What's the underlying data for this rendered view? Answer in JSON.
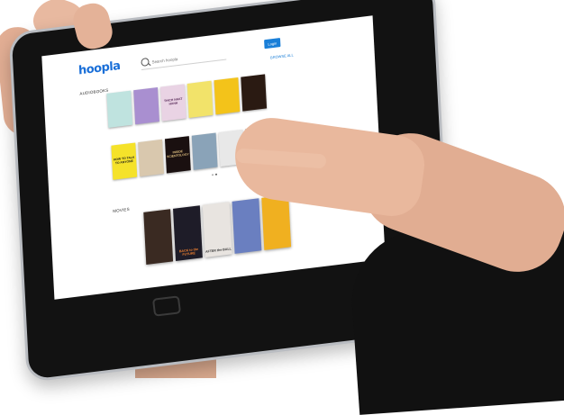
{
  "header": {
    "logo": "hoopla",
    "search_placeholder": "Search hoopla",
    "login_label": "Login",
    "browse_all_label": "BROWSE ALL"
  },
  "sections": {
    "audiobooks_label": "AUDIOBOOKS",
    "movies_label": "MOVIES"
  },
  "audiobooks_row1": [
    {
      "title": "",
      "bg": "#bfe3df",
      "fg": "#2a6a66"
    },
    {
      "title": "",
      "bg": "#a98fd0",
      "fg": "#ffffff"
    },
    {
      "title": "THICH NHAT HANH",
      "bg": "#e9d3e4",
      "fg": "#5a2c5a"
    },
    {
      "title": "",
      "bg": "#f2e36a",
      "fg": "#333333"
    },
    {
      "title": "",
      "bg": "#f3c31a",
      "fg": "#222222"
    },
    {
      "title": "",
      "bg": "#2a1a12",
      "fg": "#f0c060"
    }
  ],
  "audiobooks_row2": [
    {
      "title": "HOW TO TALK TO ANYONE",
      "bg": "#f5e22a",
      "fg": "#1a1a1a"
    },
    {
      "title": "",
      "bg": "#d9c8ae",
      "fg": "#5a3a2a"
    },
    {
      "title": "INSIDE SCIENTOLOGY",
      "bg": "#1a1010",
      "fg": "#e0c080"
    },
    {
      "title": "",
      "bg": "#8aa3b8",
      "fg": "#ffffff"
    },
    {
      "title": "",
      "bg": "#e8e8e8",
      "fg": "#333333"
    },
    {
      "title": "",
      "bg": "#3a2a2a",
      "fg": "#f0e0c0"
    }
  ],
  "movies": [
    {
      "title": "",
      "bg": "#3a2a22",
      "fg": "#ffffff"
    },
    {
      "title": "BACK to the FUTURE",
      "bg": "#1e1c28",
      "fg": "#f08030"
    },
    {
      "title": "AFTER the BALL",
      "bg": "#e8e4e0",
      "fg": "#333333"
    },
    {
      "title": "",
      "bg": "#6a7fc0",
      "fg": "#ffd24a"
    },
    {
      "title": "",
      "bg": "#f0b020",
      "fg": "#2a2a2a"
    }
  ]
}
